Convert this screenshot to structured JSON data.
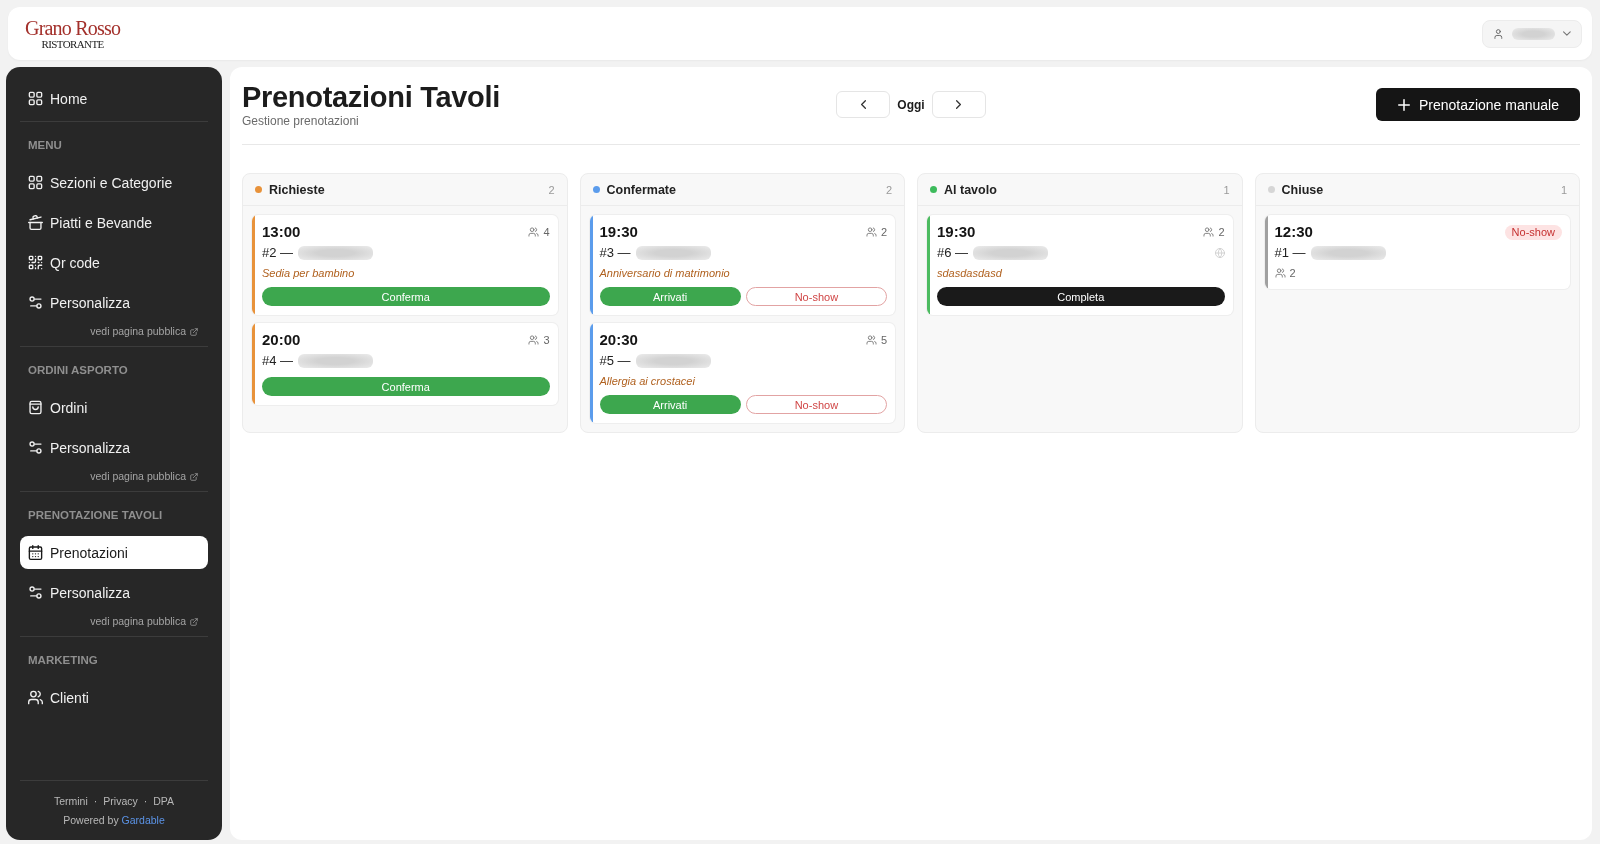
{
  "header": {
    "logo": {
      "title": "Grano Rosso",
      "subtitle": "RISTORANTE"
    },
    "user_menu": {
      "name_blurred": true
    }
  },
  "sidebar": {
    "home": {
      "label": "Home",
      "selected": false
    },
    "sections": [
      {
        "title": "MENU",
        "items": [
          {
            "label": "Sezioni e Categorie",
            "selected": false
          },
          {
            "label": "Piatti e Bevande",
            "selected": false
          },
          {
            "label": "Qr code",
            "selected": false
          },
          {
            "label": "Personalizza",
            "selected": false
          }
        ],
        "public_link": "vedi pagina pubblica"
      },
      {
        "title": "ORDINI ASPORTO",
        "items": [
          {
            "label": "Ordini",
            "selected": false
          },
          {
            "label": "Personalizza",
            "selected": false
          }
        ],
        "public_link": "vedi pagina pubblica"
      },
      {
        "title": "PRENOTAZIONE TAVOLI",
        "items": [
          {
            "label": "Prenotazioni",
            "selected": true
          },
          {
            "label": "Personalizza",
            "selected": false
          }
        ],
        "public_link": "vedi pagina pubblica"
      },
      {
        "title": "MARKETING",
        "items": [
          {
            "label": "Clienti",
            "selected": false
          }
        ]
      }
    ],
    "footer": {
      "links": [
        {
          "label": "Termini",
          "separator": "·"
        },
        {
          "label": "Privacy",
          "separator": "·"
        },
        {
          "label": "DPA"
        }
      ],
      "powered_by": "Powered by",
      "brand": "Gardable"
    }
  },
  "page": {
    "title": "Prenotazioni Tavoli",
    "subtitle": "Gestione prenotazioni",
    "date_nav": {
      "label": "Oggi"
    },
    "new_button": "Prenotazione manuale"
  },
  "columns": [
    {
      "title": "Richieste",
      "color": "#e8923a",
      "count": "2",
      "cards": [
        {
          "kind": "open",
          "color": "#e8923a",
          "time": "13:00",
          "guests": "4",
          "ref": "#2 —",
          "name_blurred": true,
          "online": false,
          "note": "Sedia per bambino",
          "actions": [
            {
              "kind": "confirm",
              "label": "Conferma"
            }
          ]
        },
        {
          "kind": "open",
          "color": "#e8923a",
          "time": "20:00",
          "guests": "3",
          "ref": "#4 —",
          "name_blurred": true,
          "online": false,
          "actions": [
            {
              "kind": "confirm",
              "label": "Conferma"
            }
          ]
        }
      ]
    },
    {
      "title": "Confermate",
      "color": "#5b9cec",
      "count": "2",
      "cards": [
        {
          "kind": "open",
          "color": "#5b9cec",
          "time": "19:30",
          "guests": "2",
          "ref": "#3 —",
          "name_blurred": true,
          "online": false,
          "note": "Anniversario di matrimonio",
          "actions": [
            {
              "kind": "arrived",
              "label": "Arrivati"
            },
            {
              "kind": "no_show",
              "label": "No-show"
            }
          ]
        },
        {
          "kind": "open",
          "color": "#5b9cec",
          "time": "20:30",
          "guests": "5",
          "ref": "#5 —",
          "name_blurred": true,
          "online": false,
          "note": "Allergia ai crostacei",
          "actions": [
            {
              "kind": "arrived",
              "label": "Arrivati"
            },
            {
              "kind": "no_show",
              "label": "No-show"
            }
          ]
        }
      ]
    },
    {
      "title": "Al tavolo",
      "color": "#3dbb5c",
      "count": "1",
      "cards": [
        {
          "kind": "open",
          "color": "#4cbb60",
          "time": "19:30",
          "guests": "2",
          "ref": "#6 —",
          "name_blurred": true,
          "online": true,
          "note": "sdasdasdasd",
          "actions": [
            {
              "kind": "complete",
              "label": "Completa"
            }
          ]
        }
      ]
    },
    {
      "title": "Chiuse",
      "color": "#d6d6d6",
      "count": "1",
      "cards": [
        {
          "kind": "closed",
          "color": "#a0a0a0",
          "time": "12:30",
          "badge": "No-show",
          "guests": "2",
          "ref": "#1 —",
          "name_blurred": true,
          "online": false
        }
      ]
    }
  ]
}
